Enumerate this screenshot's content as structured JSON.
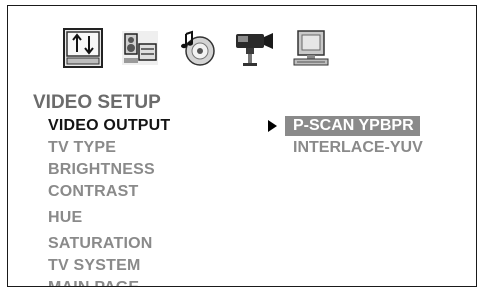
{
  "colors": {
    "title": "#6b6b6b",
    "active_item": "#141414",
    "inactive_item": "#8a8a8a",
    "selected_bg": "#8a8a8a",
    "selected_text": "#ffffff",
    "option_text": "#8a8a8a"
  },
  "icon_bar": [
    {
      "name": "general-setup-icon"
    },
    {
      "name": "audio-speaker-setup-icon"
    },
    {
      "name": "dolby-disc-setup-icon"
    },
    {
      "name": "video-camera-setup-icon"
    },
    {
      "name": "preference-monitor-setup-icon"
    }
  ],
  "section_title": "VIDEO SETUP",
  "menu": {
    "items": [
      "VIDEO OUTPUT",
      "TV TYPE",
      "BRIGHTNESS",
      "CONTRAST",
      "HUE",
      "SATURATION",
      "TV SYSTEM",
      "MAIN PAGE"
    ],
    "active_index": 0
  },
  "options": {
    "items": [
      "P-SCAN YPBPR",
      "INTERLACE-YUV"
    ],
    "selected_index": 0
  }
}
